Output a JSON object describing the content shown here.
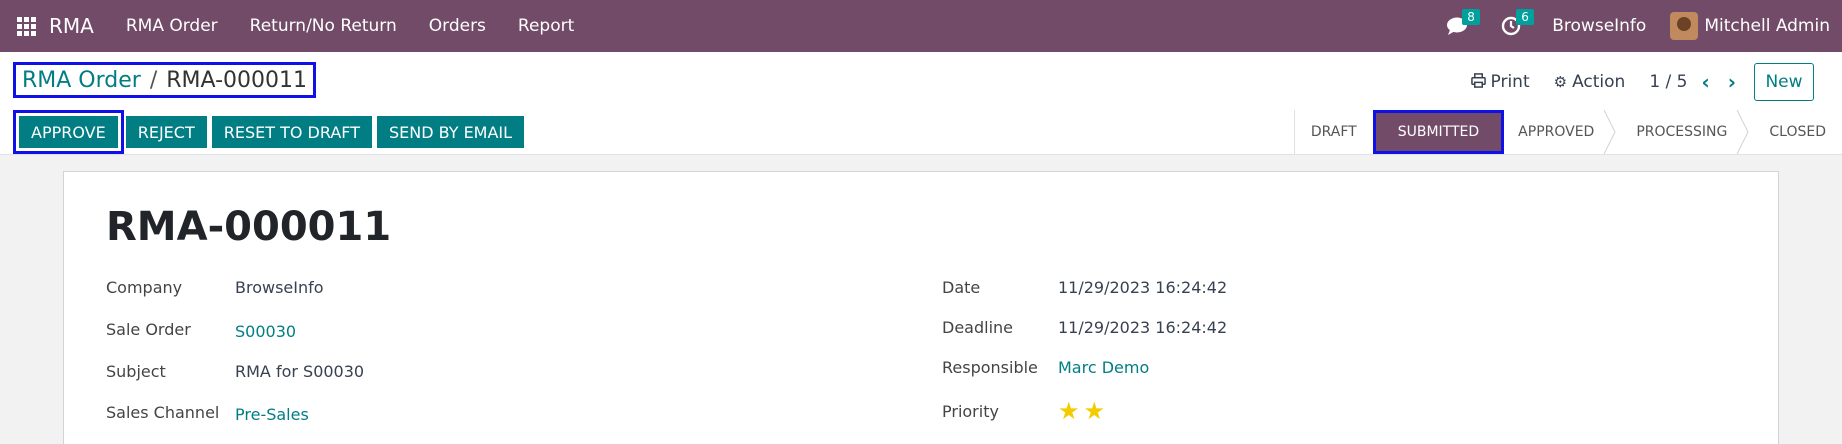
{
  "navbar": {
    "brand": "RMA",
    "menu": [
      "RMA Order",
      "Return/No Return",
      "Orders",
      "Report"
    ],
    "messages_count": "8",
    "activities_count": "6",
    "company": "BrowseInfo",
    "user": "Mitchell Admin"
  },
  "breadcrumb": {
    "parent": "RMA Order",
    "separator": "/",
    "current": "RMA-000011"
  },
  "toolbar": {
    "print": "Print",
    "action": "Action",
    "pager": "1 / 5",
    "new": "New"
  },
  "buttons": {
    "approve": "APPROVE",
    "reject": "REJECT",
    "reset": "RESET TO DRAFT",
    "email": "SEND BY EMAIL"
  },
  "statusbar": {
    "states": [
      "DRAFT",
      "SUBMITTED",
      "APPROVED",
      "PROCESSING",
      "CLOSED"
    ],
    "active": "SUBMITTED"
  },
  "form": {
    "title": "RMA-000011",
    "left": [
      {
        "label": "Company",
        "value": "BrowseInfo"
      },
      {
        "label": "Sale Order",
        "value": "S00030"
      },
      {
        "label": "Subject",
        "value": "RMA for S00030"
      },
      {
        "label": "Sales Channel",
        "value": "Pre-Sales"
      }
    ],
    "right": [
      {
        "label": "Date",
        "value": "11/29/2023 16:24:42"
      },
      {
        "label": "Deadline",
        "value": "11/29/2023 16:24:42"
      },
      {
        "label": "Responsible",
        "value": "Marc Demo"
      },
      {
        "label": "Priority",
        "value": 2,
        "max": 3
      }
    ]
  },
  "colors": {
    "navbar": "#714b67",
    "primary": "#017e84",
    "highlight": "#1010e8",
    "star": "#f3cc00"
  }
}
